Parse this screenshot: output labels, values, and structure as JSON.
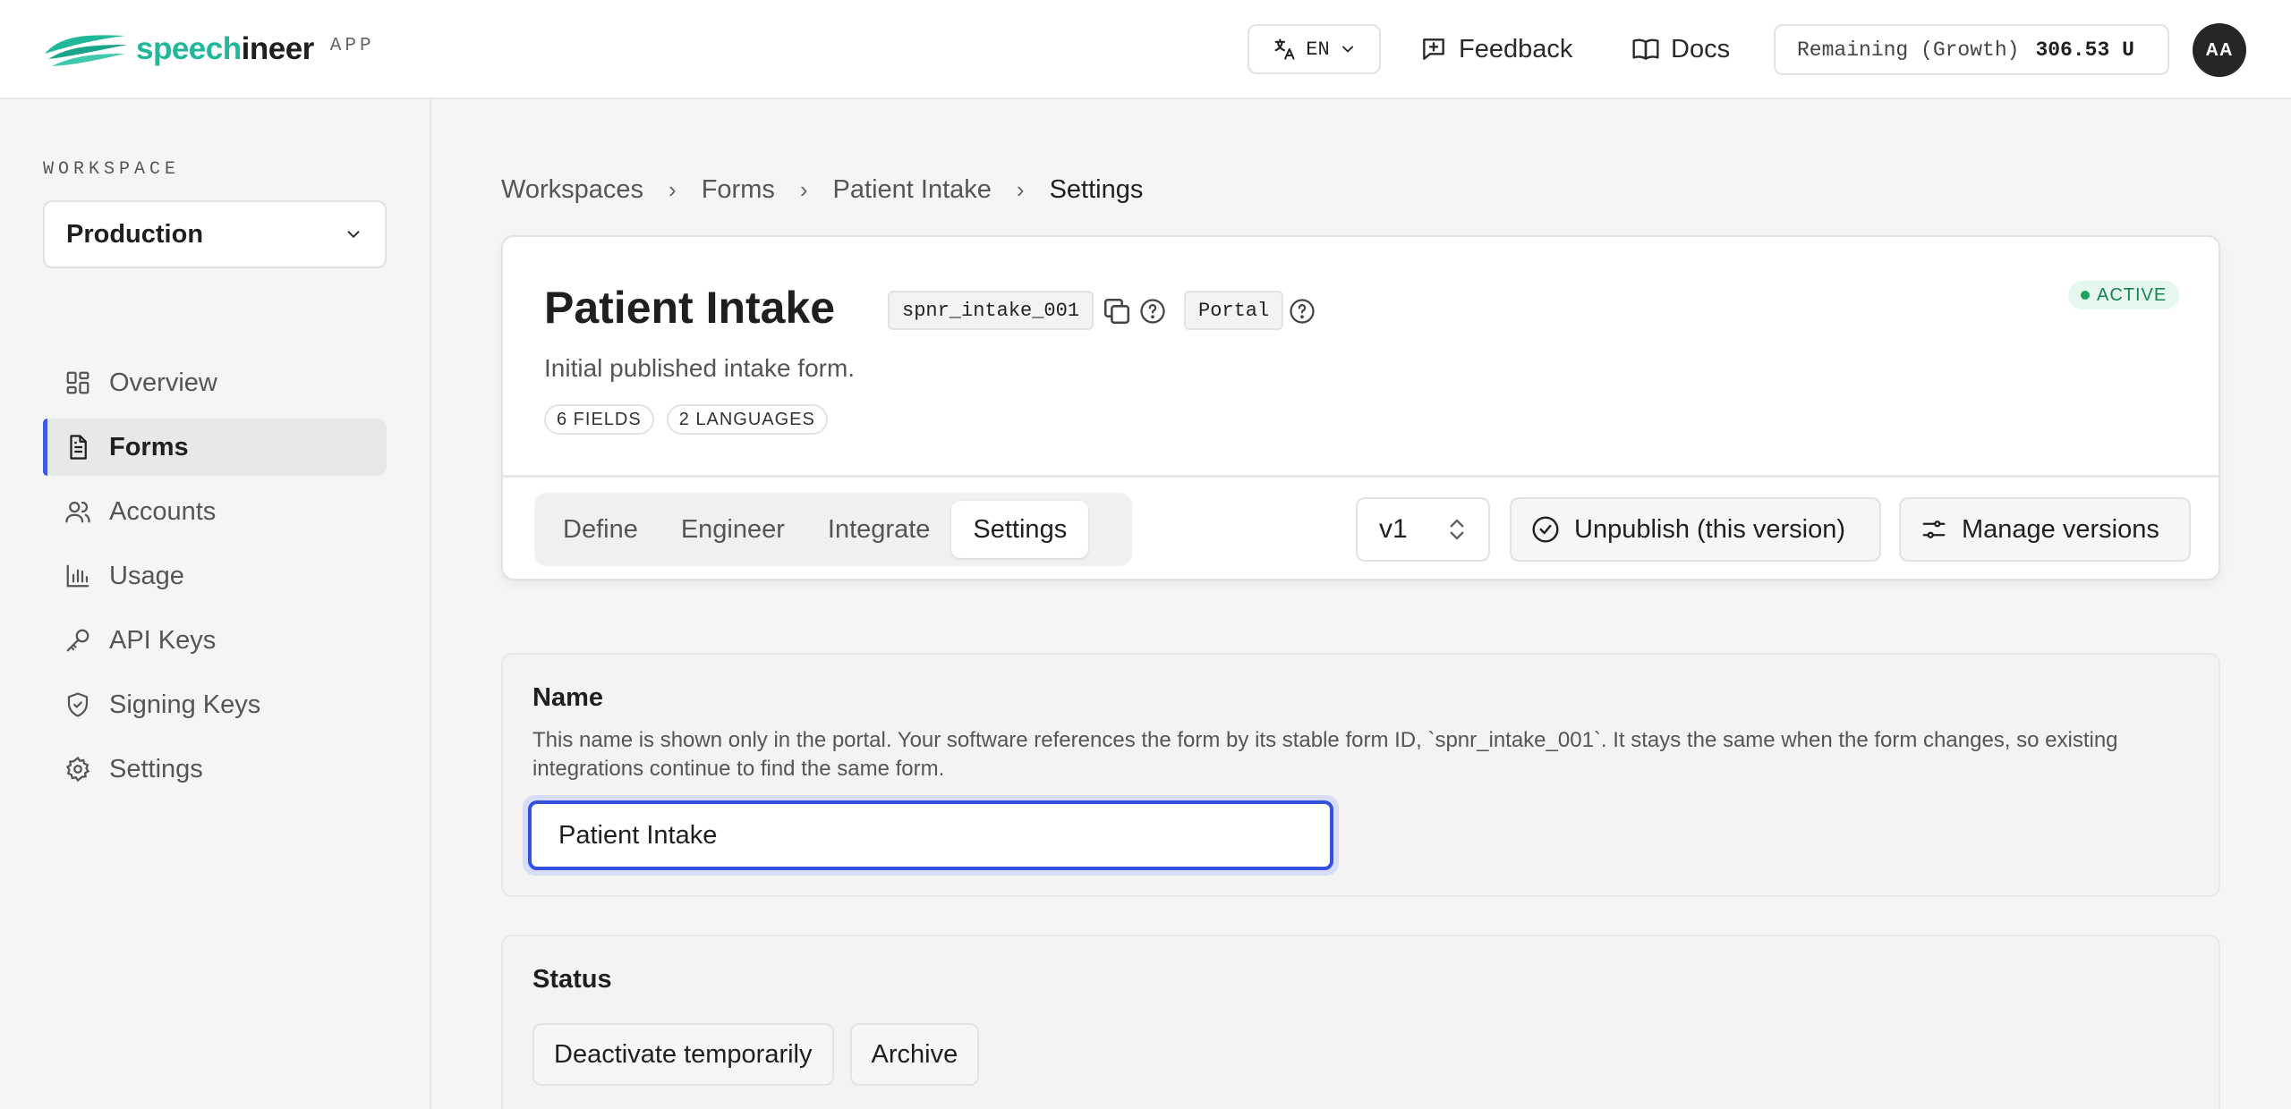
{
  "header": {
    "brand_prefix": "speech",
    "brand_suffix": "ineer",
    "brand_tag": "APP",
    "language": "EN",
    "feedback_label": "Feedback",
    "docs_label": "Docs",
    "credits_label": "Remaining (Growth)",
    "credits_value": "306.53 U",
    "avatar_initials": "AA"
  },
  "sidebar": {
    "workspace_label": "WORKSPACE",
    "workspace_value": "Production",
    "items": [
      {
        "label": "Overview",
        "icon": "dashboard-icon"
      },
      {
        "label": "Forms",
        "icon": "document-icon",
        "active": true
      },
      {
        "label": "Accounts",
        "icon": "users-icon"
      },
      {
        "label": "Usage",
        "icon": "bar-chart-icon"
      },
      {
        "label": "API Keys",
        "icon": "key-icon"
      },
      {
        "label": "Signing Keys",
        "icon": "shield-icon"
      },
      {
        "label": "Settings",
        "icon": "gear-icon"
      }
    ]
  },
  "breadcrumb": [
    "Workspaces",
    "Forms",
    "Patient Intake",
    "Settings"
  ],
  "form": {
    "title": "Patient Intake",
    "form_id": "spnr_intake_001",
    "portal_label": "Portal",
    "status": "ACTIVE",
    "description": "Initial published intake form.",
    "fields_chip": "6 FIELDS",
    "languages_chip": "2 LANGUAGES",
    "tabs": [
      "Define",
      "Engineer",
      "Integrate",
      "Settings"
    ],
    "active_tab": "Settings",
    "version": "v1",
    "unpublish_label": "Unpublish (this version)",
    "manage_label": "Manage versions"
  },
  "name_section": {
    "title": "Name",
    "help": "This name is shown only in the portal. Your software references the form by its stable form ID, `spnr_intake_001`. It stays the same when the form changes, so existing integrations continue to find the same form.",
    "value": "Patient Intake"
  },
  "status_section": {
    "title": "Status",
    "deactivate_label": "Deactivate temporarily",
    "archive_label": "Archive"
  },
  "colors": {
    "brand_teal": "#1fb89a",
    "accent_blue": "#3451e0",
    "active_green": "#14854f"
  }
}
